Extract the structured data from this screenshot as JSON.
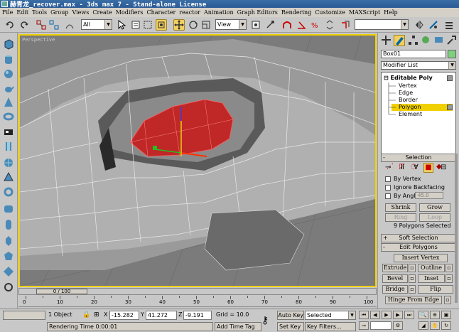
{
  "window": {
    "title": "赫青龙_recover.max - 3ds max 7 - Stand-alone License"
  },
  "menu": [
    "File",
    "Edit",
    "Tools",
    "Group",
    "Views",
    "Create",
    "Modifiers",
    "Character",
    "reactor",
    "Animation",
    "Graph Editors",
    "Rendering",
    "Customize",
    "MAXScript",
    "Help"
  ],
  "toolbar": {
    "selection_filter": "All",
    "reference_coord": "View",
    "named_selection": ""
  },
  "viewport": {
    "label": "Perspective"
  },
  "timeline": {
    "slider_label": "0 / 100",
    "ticks": [
      "0",
      "10",
      "20",
      "30",
      "40",
      "50",
      "60",
      "70",
      "80",
      "90",
      "100"
    ]
  },
  "status": {
    "objects": "1 Object",
    "x_label": "X",
    "x_value": "-15.282",
    "y_label": "Y",
    "y_value": "41.272",
    "z_label": "Z",
    "z_value": "-9.191",
    "grid": "Grid = 10.0",
    "auto_key": "Auto Key",
    "selected": "Selected",
    "set_key": "Set Key",
    "key_filters": "Key Filters...",
    "prompt": "Rendering Time  0:00:01",
    "add_time_tag": "Add Time Tag"
  },
  "command_panel": {
    "object_name": "Box01",
    "modifier_list": "Modifier List",
    "stack": {
      "header": "Editable Poly",
      "items": [
        "Vertex",
        "Edge",
        "Border",
        "Polygon",
        "Element"
      ],
      "selected": "Polygon"
    },
    "selection": {
      "title": "Selection",
      "by_vertex": "By Vertex",
      "ignore_backfacing": "Ignore Backfacing",
      "by_angle": "By Angle:",
      "angle_value": "45.0",
      "shrink": "Shrink",
      "grow": "Grow",
      "ring": "Ring",
      "loop": "Loop",
      "status": "9 Polygons Selected"
    },
    "soft_selection": {
      "title": "Soft Selection"
    },
    "edit_polygons": {
      "title": "Edit Polygons",
      "insert_vertex": "Insert Vertex",
      "extrude": "Extrude",
      "outline": "Outline",
      "bevel": "Bevel",
      "inset": "Inset",
      "bridge": "Bridge",
      "flip": "Flip",
      "hinge": "Hinge From Edge"
    }
  },
  "colors": {
    "accent": "#f0d000",
    "selected_poly": "#c42020",
    "object_color": "#7ed07e"
  }
}
